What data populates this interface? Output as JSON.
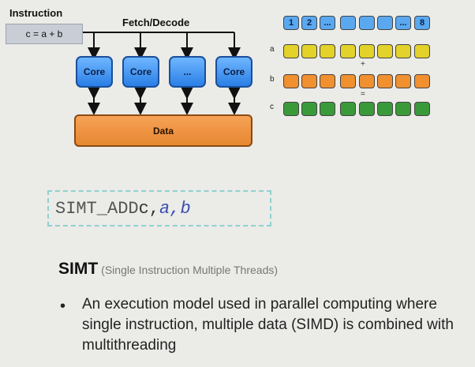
{
  "diagram": {
    "instruction_label": "Instruction",
    "instruction_text": "c = a + b",
    "fetch_decode_label": "Fetch/Decode",
    "cores": [
      "Core",
      "Core",
      "...",
      "Core"
    ],
    "data_label": "Data",
    "threads_row": [
      "1",
      "2",
      "...",
      "",
      "",
      "",
      "...",
      "8"
    ],
    "row_labels": {
      "a": "a",
      "b": "b",
      "c": "c"
    },
    "operators": {
      "plus": "+",
      "equals": "="
    },
    "colors": {
      "core_blue": "#2a7fe6",
      "data_orange": "#e78732",
      "row_a_yellow": "#e2d22a",
      "row_b_orange": "#f0902f",
      "row_c_green": "#3a9a3a",
      "thread_blue": "#5aa8f0"
    }
  },
  "code": {
    "op": "SIMT_ADD",
    "reg": "c,",
    "arg_a": "a,",
    "arg_b": "b"
  },
  "text": {
    "title": "SIMT",
    "subtitle": "(Single Instruction Multiple Threads)",
    "bullet": "An execution model used in parallel computing where single instruction, multiple data (SIMD) is combined with multithreading"
  }
}
